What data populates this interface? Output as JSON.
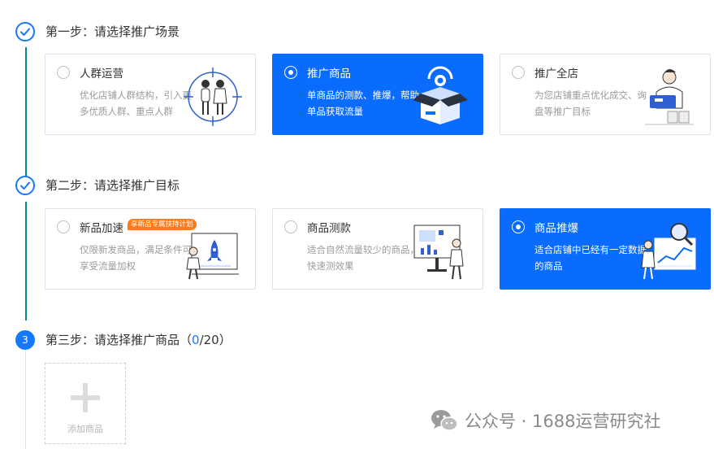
{
  "step1": {
    "title": "第一步：请选择推广场景",
    "cards": [
      {
        "title": "人群运营",
        "desc": "优化店铺人群结构，引入更多优质人群、重点人群",
        "selected": false,
        "icon": "people-target-icon"
      },
      {
        "title": "推广商品",
        "desc": "单商品的测款、推爆，帮助单品获取流量",
        "selected": true,
        "icon": "product-box-icon"
      },
      {
        "title": "推广全店",
        "desc": "为您店铺重点优化成交、询盘等推广目标",
        "selected": false,
        "icon": "store-person-icon"
      }
    ]
  },
  "step2": {
    "title": "第二步：请选择推广目标",
    "cards": [
      {
        "title": "新品加速",
        "badge": "享新品专属扶持计划",
        "desc": "仅限新发商品，满足条件可享受流量加权",
        "selected": false,
        "icon": "rocket-screen-icon"
      },
      {
        "title": "商品测款",
        "desc": "适合自然流量较少的商品，快速测效果",
        "selected": false,
        "icon": "monitor-chart-icon"
      },
      {
        "title": "商品推爆",
        "desc": "适合店铺中已经有一定数据的商品",
        "selected": true,
        "icon": "magnifier-chart-icon"
      }
    ]
  },
  "step3": {
    "number": "3",
    "title_prefix": "第三步：请选择推广商品（",
    "count": "0",
    "title_suffix": "/20）",
    "add_label": "添加商品"
  },
  "watermark": {
    "text": "公众号 · 1688运营研究社"
  },
  "colors": {
    "accent": "#1677ff",
    "selected_card": "#0a6cff",
    "step_line": "#0a8a86",
    "badge": "#ff7a1a"
  }
}
